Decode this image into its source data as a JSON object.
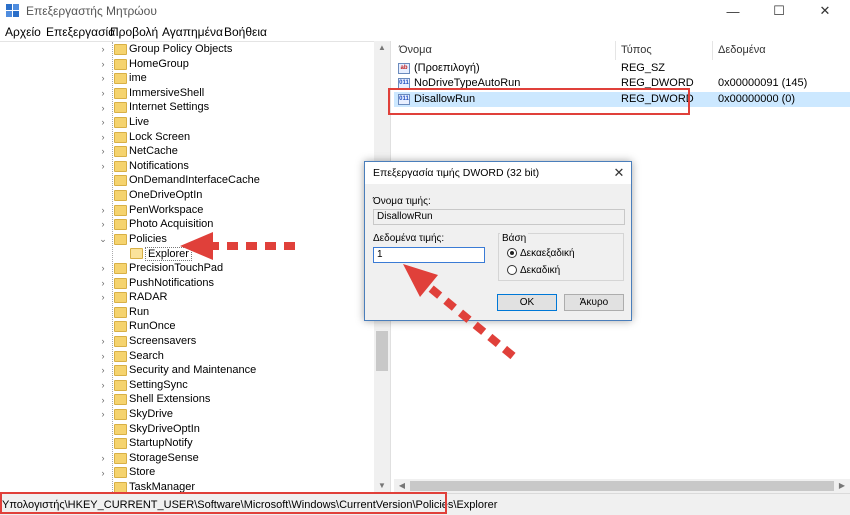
{
  "window": {
    "title": "Επεξεργαστής Μητρώου",
    "minimize": "—",
    "maximize": "☐",
    "close": "✕"
  },
  "menu": [
    "Αρχείο",
    "Επεξεργασία",
    "Προβολή",
    "Αγαπημένα",
    "Βοήθεια"
  ],
  "tree": {
    "items": [
      {
        "label": "Group Policy Objects",
        "expandable": true
      },
      {
        "label": "HomeGroup",
        "expandable": true
      },
      {
        "label": "ime",
        "expandable": true
      },
      {
        "label": "ImmersiveShell",
        "expandable": true
      },
      {
        "label": "Internet Settings",
        "expandable": true
      },
      {
        "label": "Live",
        "expandable": true
      },
      {
        "label": "Lock Screen",
        "expandable": true
      },
      {
        "label": "NetCache",
        "expandable": true
      },
      {
        "label": "Notifications",
        "expandable": true
      },
      {
        "label": "OnDemandInterfaceCache",
        "expandable": false
      },
      {
        "label": "OneDriveOptIn",
        "expandable": false
      },
      {
        "label": "PenWorkspace",
        "expandable": true
      },
      {
        "label": "Photo Acquisition",
        "expandable": true
      },
      {
        "label": "Policies",
        "expandable": true,
        "expanded": true
      },
      {
        "label": "Explorer",
        "child": true,
        "selected": true
      },
      {
        "label": "PrecisionTouchPad",
        "expandable": true
      },
      {
        "label": "PushNotifications",
        "expandable": true
      },
      {
        "label": "RADAR",
        "expandable": true
      },
      {
        "label": "Run",
        "expandable": false
      },
      {
        "label": "RunOnce",
        "expandable": false
      },
      {
        "label": "Screensavers",
        "expandable": true
      },
      {
        "label": "Search",
        "expandable": true
      },
      {
        "label": "Security and Maintenance",
        "expandable": true
      },
      {
        "label": "SettingSync",
        "expandable": true
      },
      {
        "label": "Shell Extensions",
        "expandable": true
      },
      {
        "label": "SkyDrive",
        "expandable": true
      },
      {
        "label": "SkyDriveOptIn",
        "expandable": false
      },
      {
        "label": "StartupNotify",
        "expandable": false
      },
      {
        "label": "StorageSense",
        "expandable": true
      },
      {
        "label": "Store",
        "expandable": true
      },
      {
        "label": "TaskManager",
        "expandable": false
      }
    ]
  },
  "values": {
    "headers": {
      "name": "Όνομα",
      "type": "Τύπος",
      "data": "Δεδομένα"
    },
    "rows": [
      {
        "icon": "ab",
        "name": "(Προεπιλογή)",
        "type": "REG_SZ",
        "data": ""
      },
      {
        "icon": "011",
        "name": "NoDriveTypeAutoRun",
        "type": "REG_DWORD",
        "data": "0x00000091 (145)"
      },
      {
        "icon": "011",
        "name": "DisallowRun",
        "type": "REG_DWORD",
        "data": "0x00000000 (0)",
        "selected": true
      }
    ]
  },
  "dialog": {
    "title": "Επεξεργασία τιμής DWORD (32 bit)",
    "close": "✕",
    "name_label": "Όνομα τιμής:",
    "name_value": "DisallowRun",
    "data_label": "Δεδομένα τιμής:",
    "data_value": "1",
    "base_label": "Βάση",
    "radio_hex": "Δεκαεξαδική",
    "radio_dec": "Δεκαδική",
    "base_selected": "hex",
    "ok": "ΟΚ",
    "cancel": "Άκυρο"
  },
  "status": {
    "path": "Υπολογιστής\\HKEY_CURRENT_USER\\Software\\Microsoft\\Windows\\CurrentVersion\\Policies\\Explorer"
  },
  "colors": {
    "highlight": "#e0403a",
    "selection": "#cce8ff",
    "accent": "#0078d7"
  }
}
